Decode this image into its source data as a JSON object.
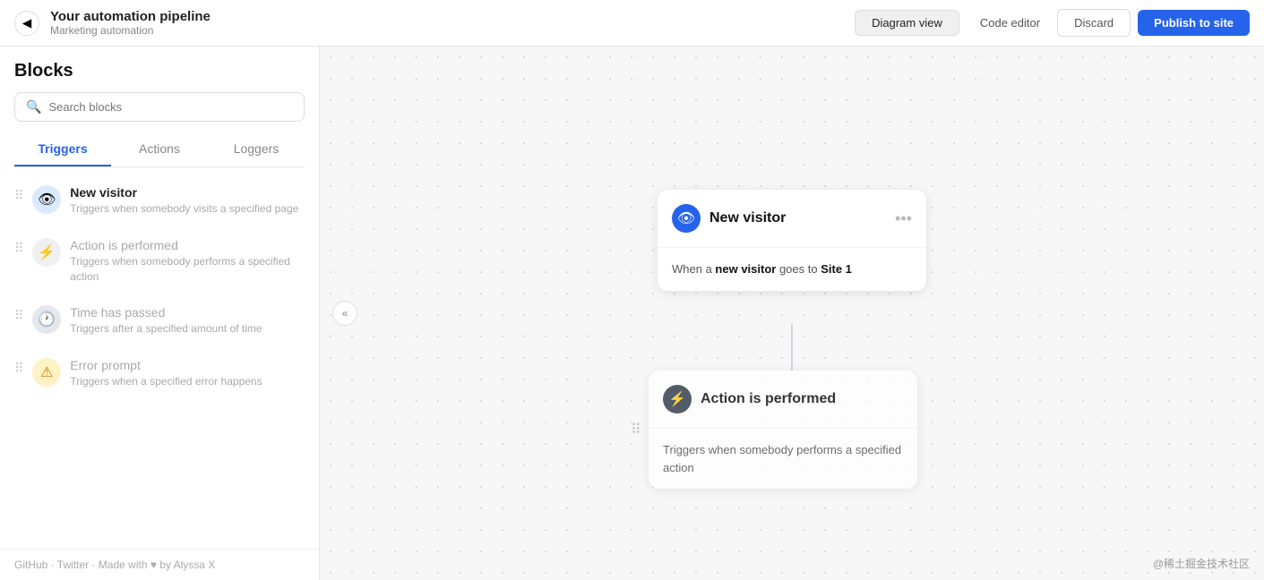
{
  "header": {
    "back_icon": "◀",
    "title": "Your automation pipeline",
    "subtitle": "Marketing automation",
    "tabs": [
      {
        "label": "Diagram view",
        "active": true
      },
      {
        "label": "Code editor",
        "active": false
      }
    ],
    "discard_label": "Discard",
    "publish_label": "Publish to site"
  },
  "sidebar": {
    "title": "Blocks",
    "search_placeholder": "Search blocks",
    "tabs": [
      {
        "label": "Triggers",
        "active": true
      },
      {
        "label": "Actions",
        "active": false
      },
      {
        "label": "Loggers",
        "active": false
      }
    ],
    "blocks": [
      {
        "name": "New visitor",
        "desc": "Triggers when somebody visits a specified page",
        "icon_type": "blue",
        "icon_glyph": "👁",
        "muted": false
      },
      {
        "name": "Action is performed",
        "desc": "Triggers when somebody performs a specified action",
        "icon_type": "gray",
        "icon_glyph": "⚡",
        "muted": true
      },
      {
        "name": "Time has passed",
        "desc": "Triggers after a specified amount of time",
        "icon_type": "dark",
        "icon_glyph": "🕐",
        "muted": true
      },
      {
        "name": "Error prompt",
        "desc": "Triggers when a specified error happens",
        "icon_type": "orange",
        "icon_glyph": "⚠",
        "muted": true
      }
    ],
    "footer": "GitHub · Twitter · Made with ♥ by Alyssa X"
  },
  "canvas": {
    "card1": {
      "title": "New visitor",
      "icon_glyph": "👁",
      "menu": "•••",
      "desc_prefix": "When a ",
      "desc_bold1": "new visitor",
      "desc_mid": " goes to ",
      "desc_bold2": "Site 1"
    },
    "card2": {
      "title": "Action is performed",
      "icon_glyph": "⚡",
      "drag_icon": "⠿",
      "desc": "Triggers when somebody performs a specified action"
    }
  },
  "watermark": "@稀土掘金技术社区"
}
